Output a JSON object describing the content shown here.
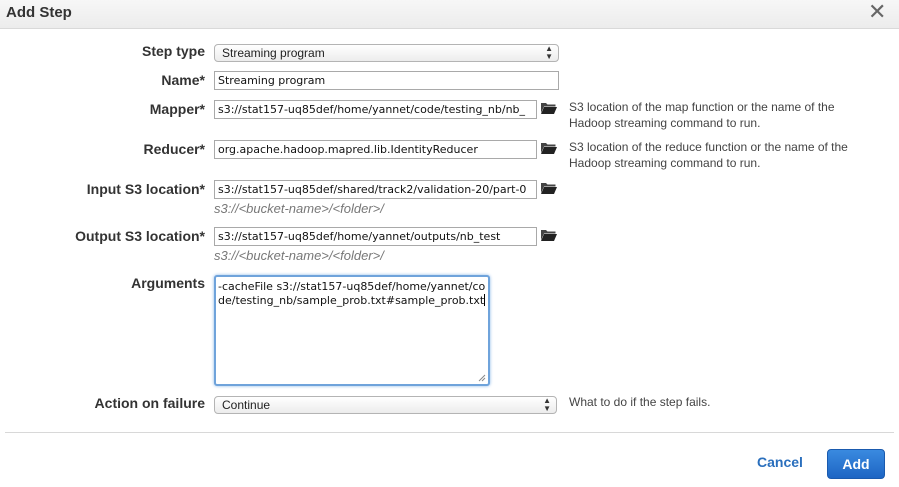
{
  "dialog": {
    "title": "Add Step",
    "close_symbol": "✕"
  },
  "form": {
    "step_type": {
      "label": "Step type",
      "value": "Streaming program"
    },
    "name": {
      "label": "Name*",
      "value": "Streaming program"
    },
    "mapper": {
      "label": "Mapper*",
      "value": "s3://stat157-uq85def/home/yannet/code/testing_nb/nb_",
      "help": [
        "S3 location of the map function or the name of the",
        "Hadoop streaming command to run."
      ]
    },
    "reducer": {
      "label": "Reducer*",
      "value": "org.apache.hadoop.mapred.lib.IdentityReducer",
      "help": [
        "S3 location of the reduce function or the name of the",
        "Hadoop streaming command to run."
      ]
    },
    "input": {
      "label": "Input S3 location*",
      "value": "s3://stat157-uq85def/shared/track2/validation-20/part-0",
      "hint": "s3://<bucket-name>/<folder>/"
    },
    "output": {
      "label": "Output S3 location*",
      "value": "s3://stat157-uq85def/home/yannet/outputs/nb_test",
      "hint": "s3://<bucket-name>/<folder>/"
    },
    "arguments": {
      "label": "Arguments",
      "value": "-cacheFile s3://stat157-uq85def/home/yannet/code/testing_nb/sample_prob.txt#sample_prob.txt"
    },
    "action_on_failure": {
      "label": "Action on failure",
      "value": "Continue",
      "help": "What to do if the step fails."
    }
  },
  "footer": {
    "cancel_label": "Cancel",
    "add_label": "Add"
  },
  "icons": {
    "folder": "folder-open-icon",
    "close": "close-icon"
  },
  "colors": {
    "primary": "#2a6fbd",
    "focus": "#6fa3db"
  }
}
